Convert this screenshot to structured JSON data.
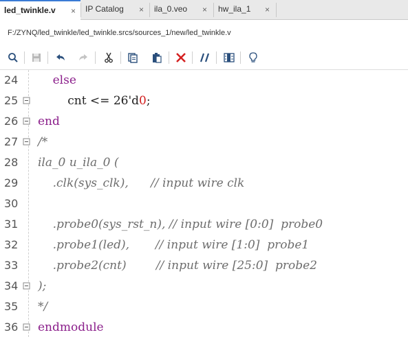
{
  "tabs": [
    {
      "label": "led_twinkle.v",
      "active": true
    },
    {
      "label": "IP Catalog",
      "active": false
    },
    {
      "label": "ila_0.veo",
      "active": false
    },
    {
      "label": "hw_ila_1",
      "active": false
    }
  ],
  "tab_close_glyph": "×",
  "file_path": "F:/ZYNQ/led_twinkle/led_twinkle.srcs/sources_1/new/led_twinkle.v",
  "toolbar_icons": [
    "search-icon",
    "save-icon",
    "undo-icon",
    "redo-icon",
    "cut-icon",
    "copy-icon",
    "paste-icon",
    "delete-icon",
    "comment-icon",
    "column-select-icon",
    "hint-icon"
  ],
  "colors": {
    "keyword": "#8b1f8b",
    "comment": "#6d6d6d",
    "number": "#d11b1b",
    "delete": "#d42020",
    "tab_accent": "#3a7bd5"
  },
  "code_lines": [
    {
      "num": "24",
      "fold": "none",
      "segments": [
        {
          "t": "    ",
          "c": "txt"
        },
        {
          "t": "else",
          "c": "kw"
        }
      ]
    },
    {
      "num": "25",
      "fold": "end",
      "segments": [
        {
          "t": "        cnt <= 26",
          "c": "txt"
        },
        {
          "t": "'d",
          "c": "txt"
        },
        {
          "t": "0",
          "c": "num"
        },
        {
          "t": ";",
          "c": "txt"
        }
      ]
    },
    {
      "num": "26",
      "fold": "end",
      "segments": [
        {
          "t": "end",
          "c": "kw"
        }
      ]
    },
    {
      "num": "27",
      "fold": "start",
      "segments": [
        {
          "t": "/*",
          "c": "cm"
        }
      ]
    },
    {
      "num": "28",
      "fold": "none",
      "segments": [
        {
          "t": "ila_0 u_ila_0 (",
          "c": "cm"
        }
      ]
    },
    {
      "num": "29",
      "fold": "none",
      "segments": [
        {
          "t": "    .clk(sys_clk),      // input wire clk",
          "c": "cm"
        }
      ]
    },
    {
      "num": "30",
      "fold": "none",
      "segments": [
        {
          "t": "",
          "c": "cm"
        }
      ]
    },
    {
      "num": "31",
      "fold": "none",
      "segments": [
        {
          "t": "    .probe0(sys_rst_n), // input wire [0:0]  probe0",
          "c": "cm"
        }
      ]
    },
    {
      "num": "32",
      "fold": "none",
      "segments": [
        {
          "t": "    .probe1(led),       // input wire [1:0]  probe1",
          "c": "cm"
        }
      ]
    },
    {
      "num": "33",
      "fold": "none",
      "segments": [
        {
          "t": "    .probe2(cnt)        // input wire [25:0]  probe2",
          "c": "cm"
        }
      ]
    },
    {
      "num": "34",
      "fold": "end",
      "segments": [
        {
          "t": ");",
          "c": "cm"
        }
      ]
    },
    {
      "num": "35",
      "fold": "none",
      "segments": [
        {
          "t": "*/",
          "c": "cm"
        }
      ]
    },
    {
      "num": "36",
      "fold": "end",
      "segments": [
        {
          "t": "endmodule",
          "c": "kw"
        }
      ]
    }
  ]
}
